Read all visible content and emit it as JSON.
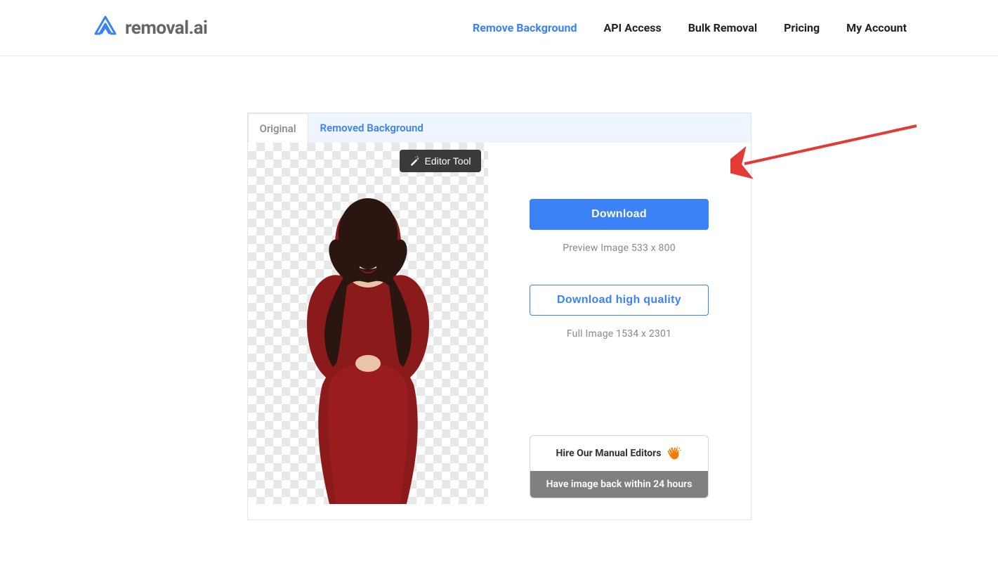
{
  "brand": {
    "name": "removal.ai"
  },
  "nav": {
    "items": [
      {
        "label": "Remove Background",
        "active": true
      },
      {
        "label": "API Access",
        "active": false
      },
      {
        "label": "Bulk Removal",
        "active": false
      },
      {
        "label": "Pricing",
        "active": false
      },
      {
        "label": "My Account",
        "active": false
      }
    ]
  },
  "tabs": {
    "original": "Original",
    "removed": "Removed Background"
  },
  "editor_tool": {
    "label": "Editor Tool"
  },
  "actions": {
    "download_label": "Download",
    "preview_meta": "Preview Image   533 x 800",
    "download_hq_label": "Download high quality",
    "full_meta": "Full Image   1534 x 2301"
  },
  "hire": {
    "title": "Hire Our Manual Editors",
    "subtitle": "Have image back within 24 hours"
  }
}
